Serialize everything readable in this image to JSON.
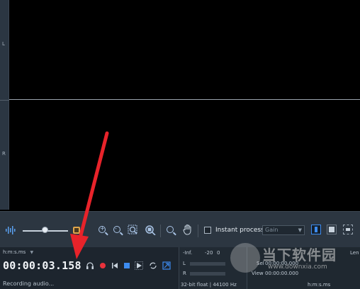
{
  "channels": {
    "left": "L",
    "right": "R"
  },
  "toolbar": {
    "instant_process_label": "Instant process",
    "instant_process_checked": false,
    "gain_value": "Gain"
  },
  "display": {
    "time_format": "h:m:s.ms",
    "current_time": "00:00:03.158",
    "status": "Recording audio..."
  },
  "meter": {
    "inf_label": "-Inf.",
    "db_label": "-20",
    "zero_label": "0",
    "left_label": "L",
    "right_label": "R",
    "format": "32-bit float | 44100 Hz"
  },
  "selection": {
    "start_label": "Sel",
    "start_value": "00:00:00.000",
    "view_label": "View",
    "view_value": "00:00:00.000",
    "length_label": "Len",
    "time_format": "h:m:s.ms"
  },
  "watermark": {
    "logo_text": "当下软件园",
    "url": "www.downxia.com"
  },
  "colors": {
    "accent": "#3d8cf0",
    "record": "#e8323c",
    "arrow": "#e8232a"
  }
}
